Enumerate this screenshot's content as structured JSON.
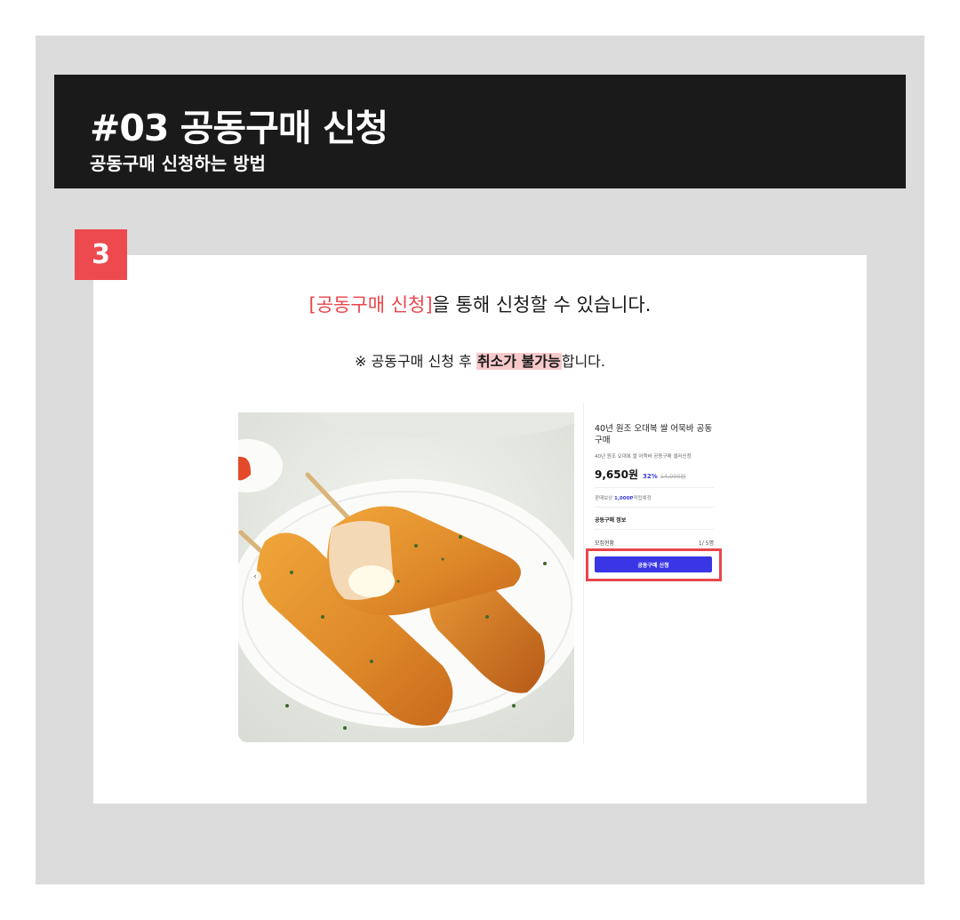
{
  "header": {
    "title": "#03 공동구매 신청",
    "subtitle": "공동구매 신청하는 방법"
  },
  "step": {
    "number": "3"
  },
  "instructions": {
    "headline_highlight": "[공동구매 신청]",
    "headline_rest": "을 통해 신청할 수 있습니다.",
    "notice_prefix": "※ 공동구매 신청 후 ",
    "notice_mark": "취소가 불가능",
    "notice_suffix": "합니다."
  },
  "product": {
    "title": "40년 원조 오대복 쌀 어묵바 공동구매",
    "subtitle": "40년 원조 오대복 쌀 어묵바 공동구매 셀러신청",
    "price": "9,650원",
    "discount": "32%",
    "original_price": "14,000원",
    "reward_label": "판매보상",
    "reward_points": "1,000P",
    "reward_suffix": "적립예정",
    "section_label": "공동구매 정보",
    "recruit_label": "모집현황",
    "recruit_value": "1/ 5명",
    "apply_button": "공동구매 신청",
    "image_prev_icon": "chevron-left-icon"
  },
  "colors": {
    "accent_red": "#e8464c",
    "button_blue": "#3a36e6",
    "header_bg": "#1b1a1a",
    "frame_bg": "#dcdcdc"
  }
}
